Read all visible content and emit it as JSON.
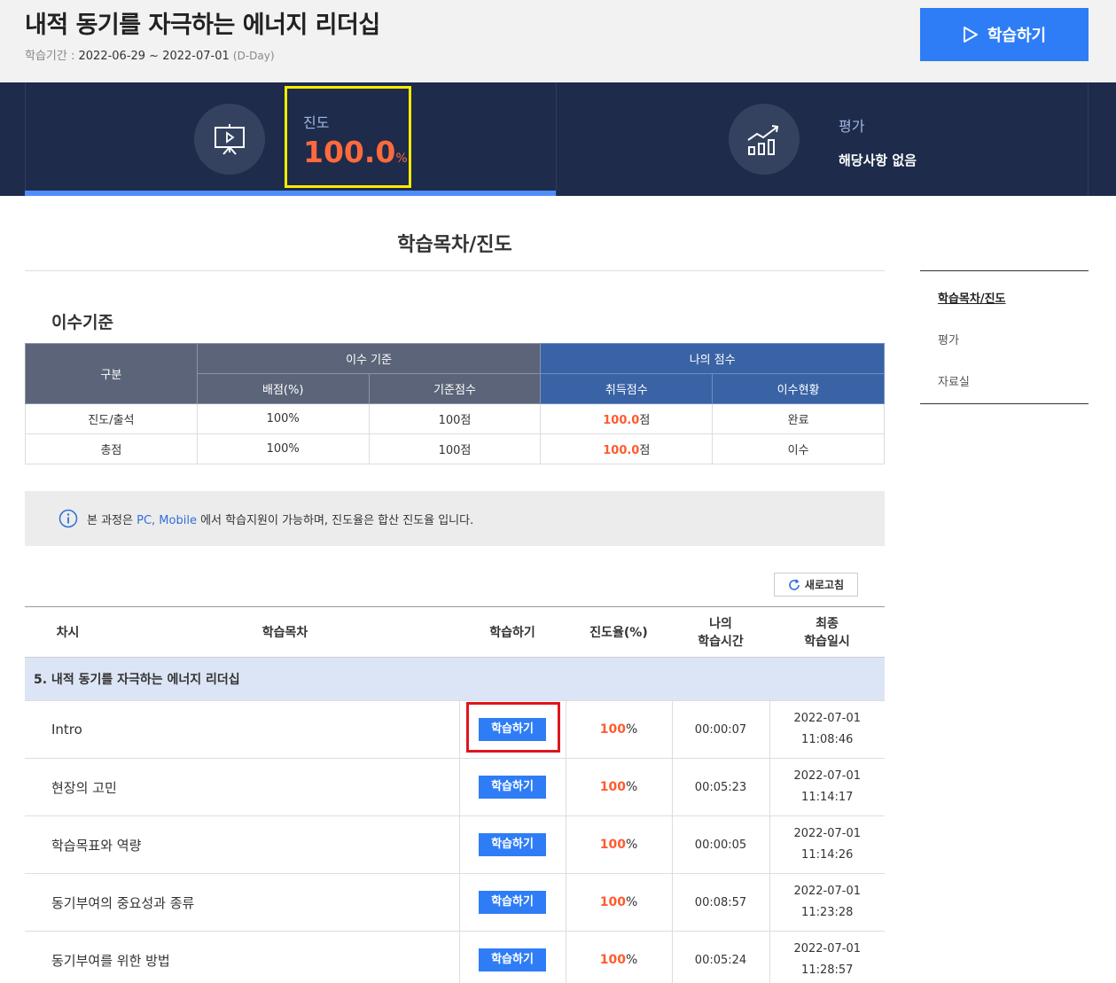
{
  "header": {
    "course_title": "내적 동기를 자극하는 에너지 리더십",
    "period_label": "학습기간 :",
    "period_value": "2022-06-29 ~ 2022-07-01",
    "dday": "(D-Day)",
    "study_button": "학습하기"
  },
  "stats": {
    "progress_label": "진도",
    "progress_value": "100.0",
    "progress_unit": "%",
    "progress_fraction": 1.0,
    "eval_label": "평가",
    "eval_value": "해당사항 없음"
  },
  "section_title": "학습목차/진도",
  "side_menu": [
    "학습목차/진도",
    "평가",
    "자료실"
  ],
  "criteria": {
    "title": "이수기준",
    "headers": {
      "category": "구분",
      "criteria_group": "이수 기준",
      "score_group": "나의 점수",
      "weight": "배점(%)",
      "base_score": "기준점수",
      "earned": "취득점수",
      "status": "이수현황"
    },
    "rows": [
      {
        "category": "진도/출석",
        "weight": "100%",
        "base": "100점",
        "earned": "100.0",
        "earned_unit": "점",
        "status": "완료"
      },
      {
        "category": "총점",
        "weight": "100%",
        "base": "100점",
        "earned": "100.0",
        "earned_unit": "점",
        "status": "이수"
      }
    ]
  },
  "info": {
    "pre": "본 과정은",
    "link": "PC, Mobile",
    "post": "에서 학습지원이 가능하며, 진도율은 합산 진도율 입니다."
  },
  "refresh_label": "새로고침",
  "lessons": {
    "headers": {
      "no": "차시",
      "title": "학습목차",
      "study": "학습하기",
      "progress": "진도율(%)",
      "time_l1": "나의",
      "time_l2": "학습시간",
      "last_l1": "최종",
      "last_l2": "학습일시"
    },
    "group": "5. 내적 동기를 자극하는 에너지 리더십",
    "study_btn": "학습하기",
    "rows": [
      {
        "title": "Intro",
        "progress": "100",
        "unit": "%",
        "time": "00:00:07",
        "date": "2022-07-01",
        "clock": "11:08:46"
      },
      {
        "title": "현장의 고민",
        "progress": "100",
        "unit": "%",
        "time": "00:05:23",
        "date": "2022-07-01",
        "clock": "11:14:17"
      },
      {
        "title": "학습목표와 역량",
        "progress": "100",
        "unit": "%",
        "time": "00:00:05",
        "date": "2022-07-01",
        "clock": "11:14:26"
      },
      {
        "title": "동기부여의 중요성과 종류",
        "progress": "100",
        "unit": "%",
        "time": "00:08:57",
        "date": "2022-07-01",
        "clock": "11:23:28"
      },
      {
        "title": "동기부여를 위한 방법",
        "progress": "100",
        "unit": "%",
        "time": "00:05:24",
        "date": "2022-07-01",
        "clock": "11:28:57"
      }
    ]
  }
}
